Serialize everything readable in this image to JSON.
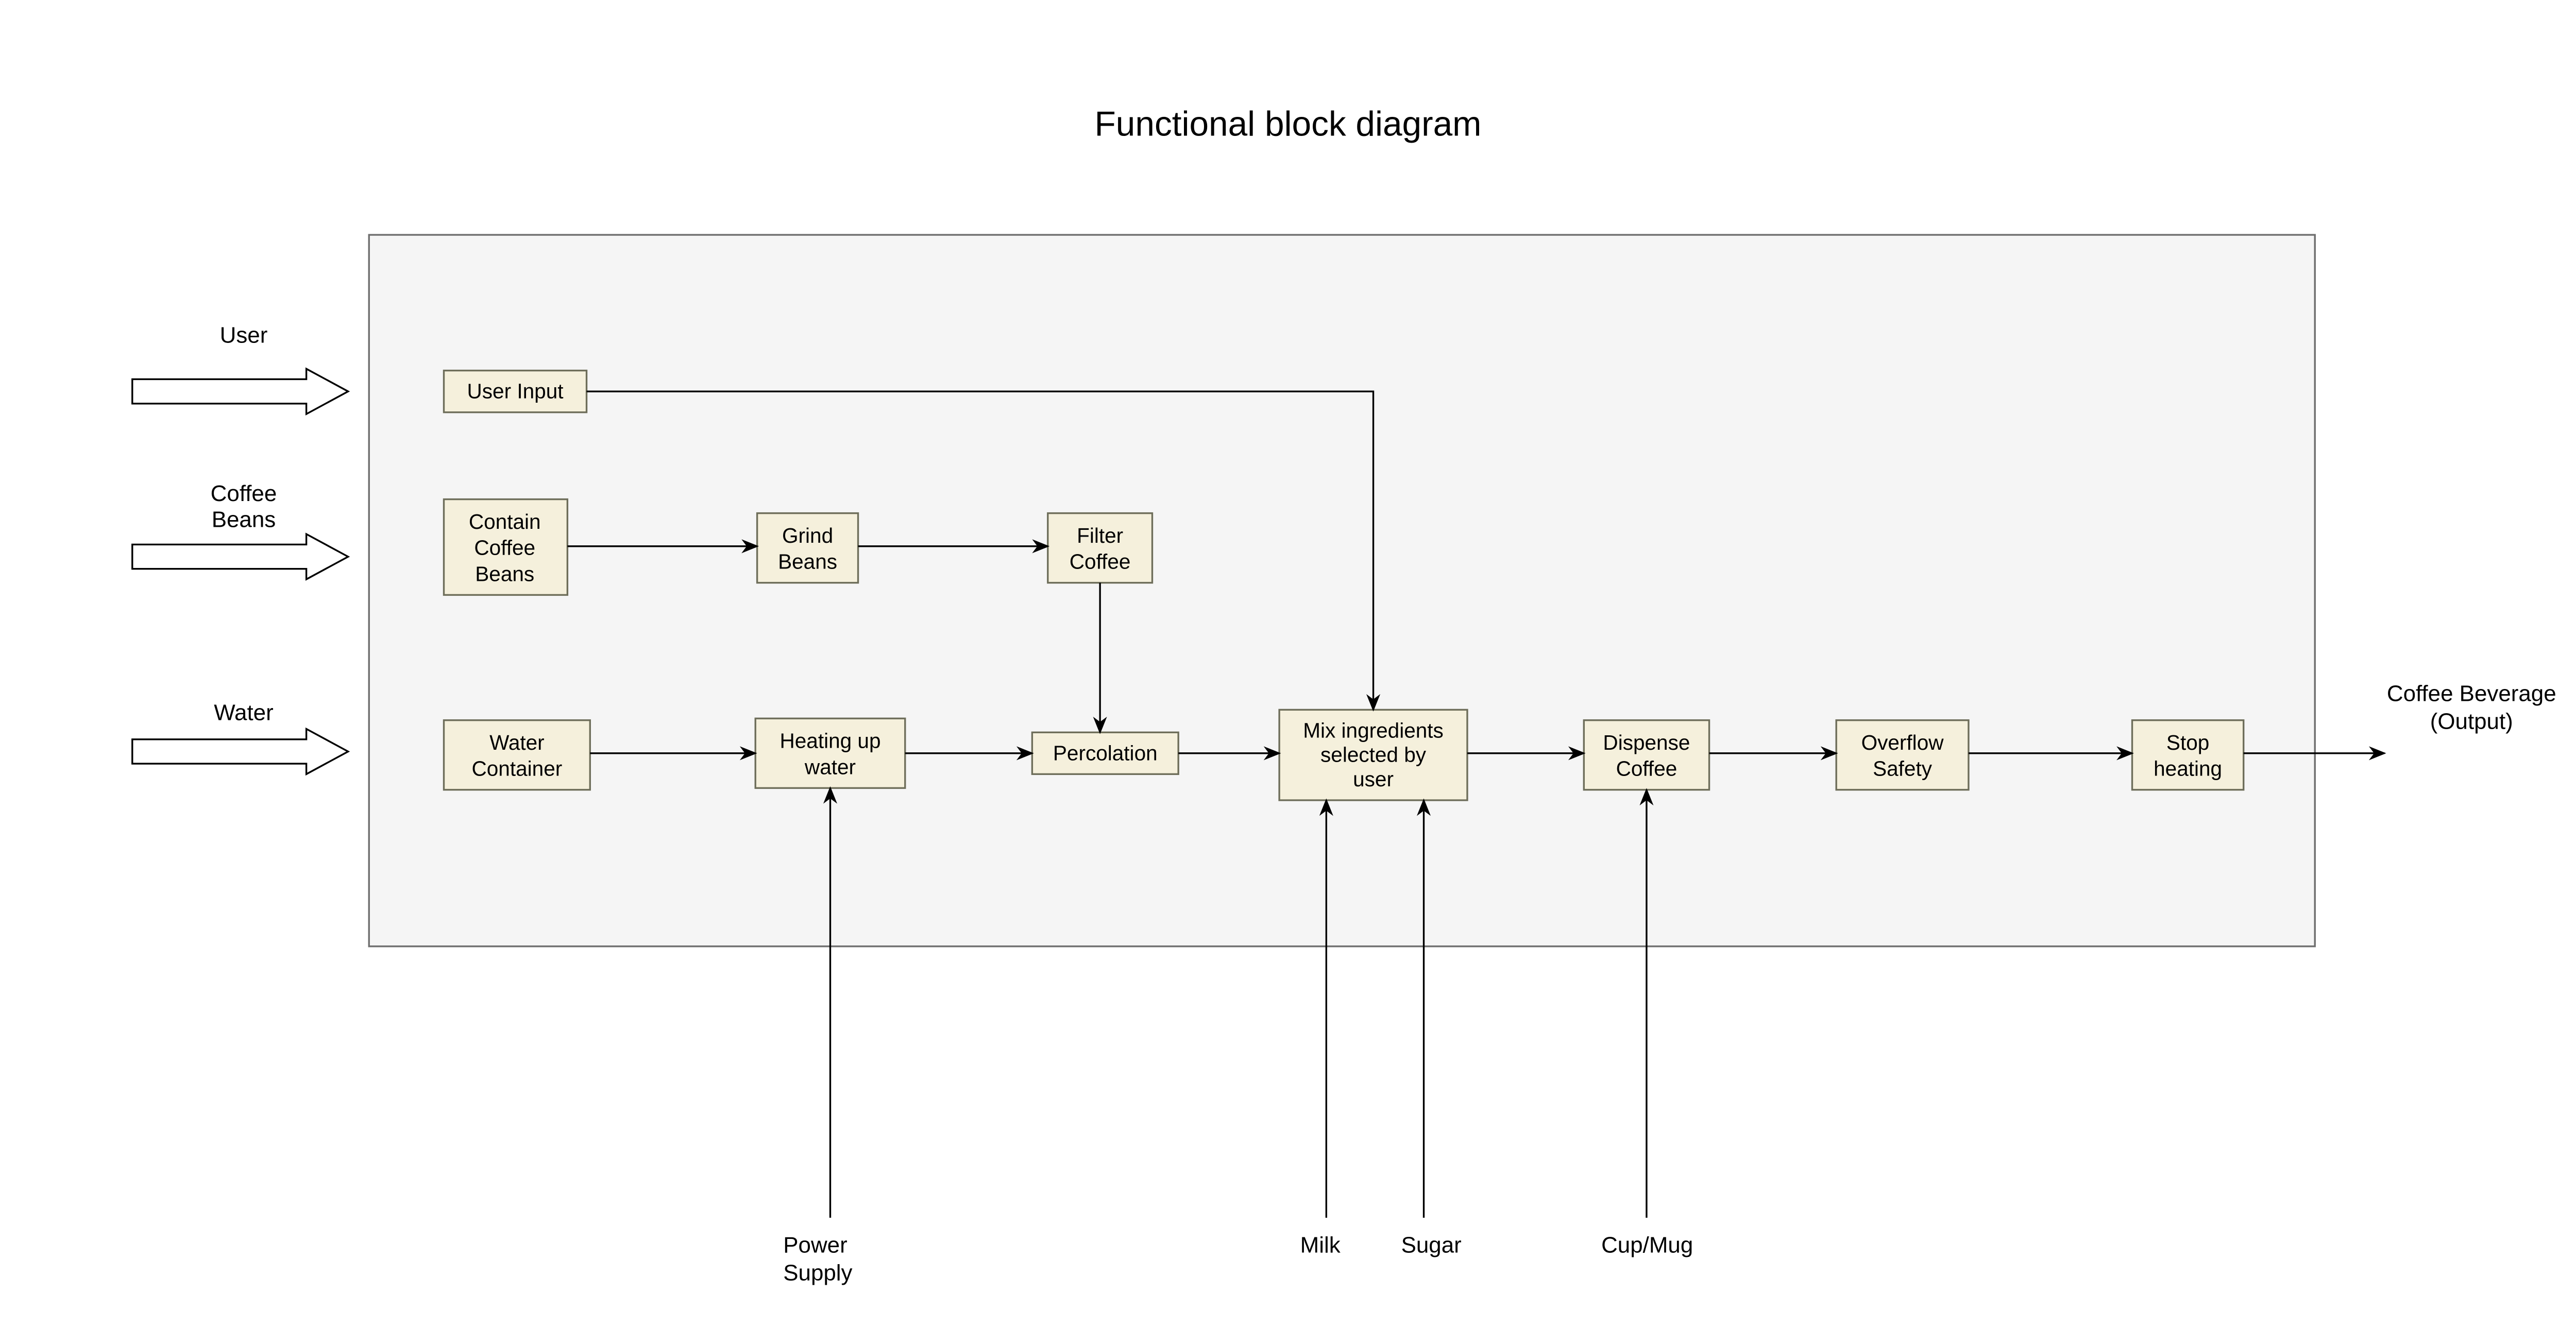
{
  "title": "Functional block diagram",
  "inputs": {
    "user": "User",
    "coffee_beans_l1": "Coffee",
    "coffee_beans_l2": "Beans",
    "water": "Water"
  },
  "blocks": {
    "user_input": "User Input",
    "contain_l1": "Contain",
    "contain_l2": "Coffee",
    "contain_l3": "Beans",
    "grind_l1": "Grind",
    "grind_l2": "Beans",
    "filter_l1": "Filter",
    "filter_l2": "Coffee",
    "water_l1": "Water",
    "water_l2": "Container",
    "heat_l1": "Heating up",
    "heat_l2": "water",
    "percolation": "Percolation",
    "mix_l1": "Mix ingredients",
    "mix_l2": "selected by",
    "mix_l3": "user",
    "dispense_l1": "Dispense",
    "dispense_l2": "Coffee",
    "overflow_l1": "Overflow",
    "overflow_l2": "Safety",
    "stop_l1": "Stop",
    "stop_l2": "heating"
  },
  "bottom_inputs": {
    "power_l1": "Power",
    "power_l2": "Supply",
    "milk": "Milk",
    "sugar": "Sugar",
    "cup": "Cup/Mug"
  },
  "output": {
    "l1": "Coffee Beverage",
    "l2": "(Output)"
  }
}
